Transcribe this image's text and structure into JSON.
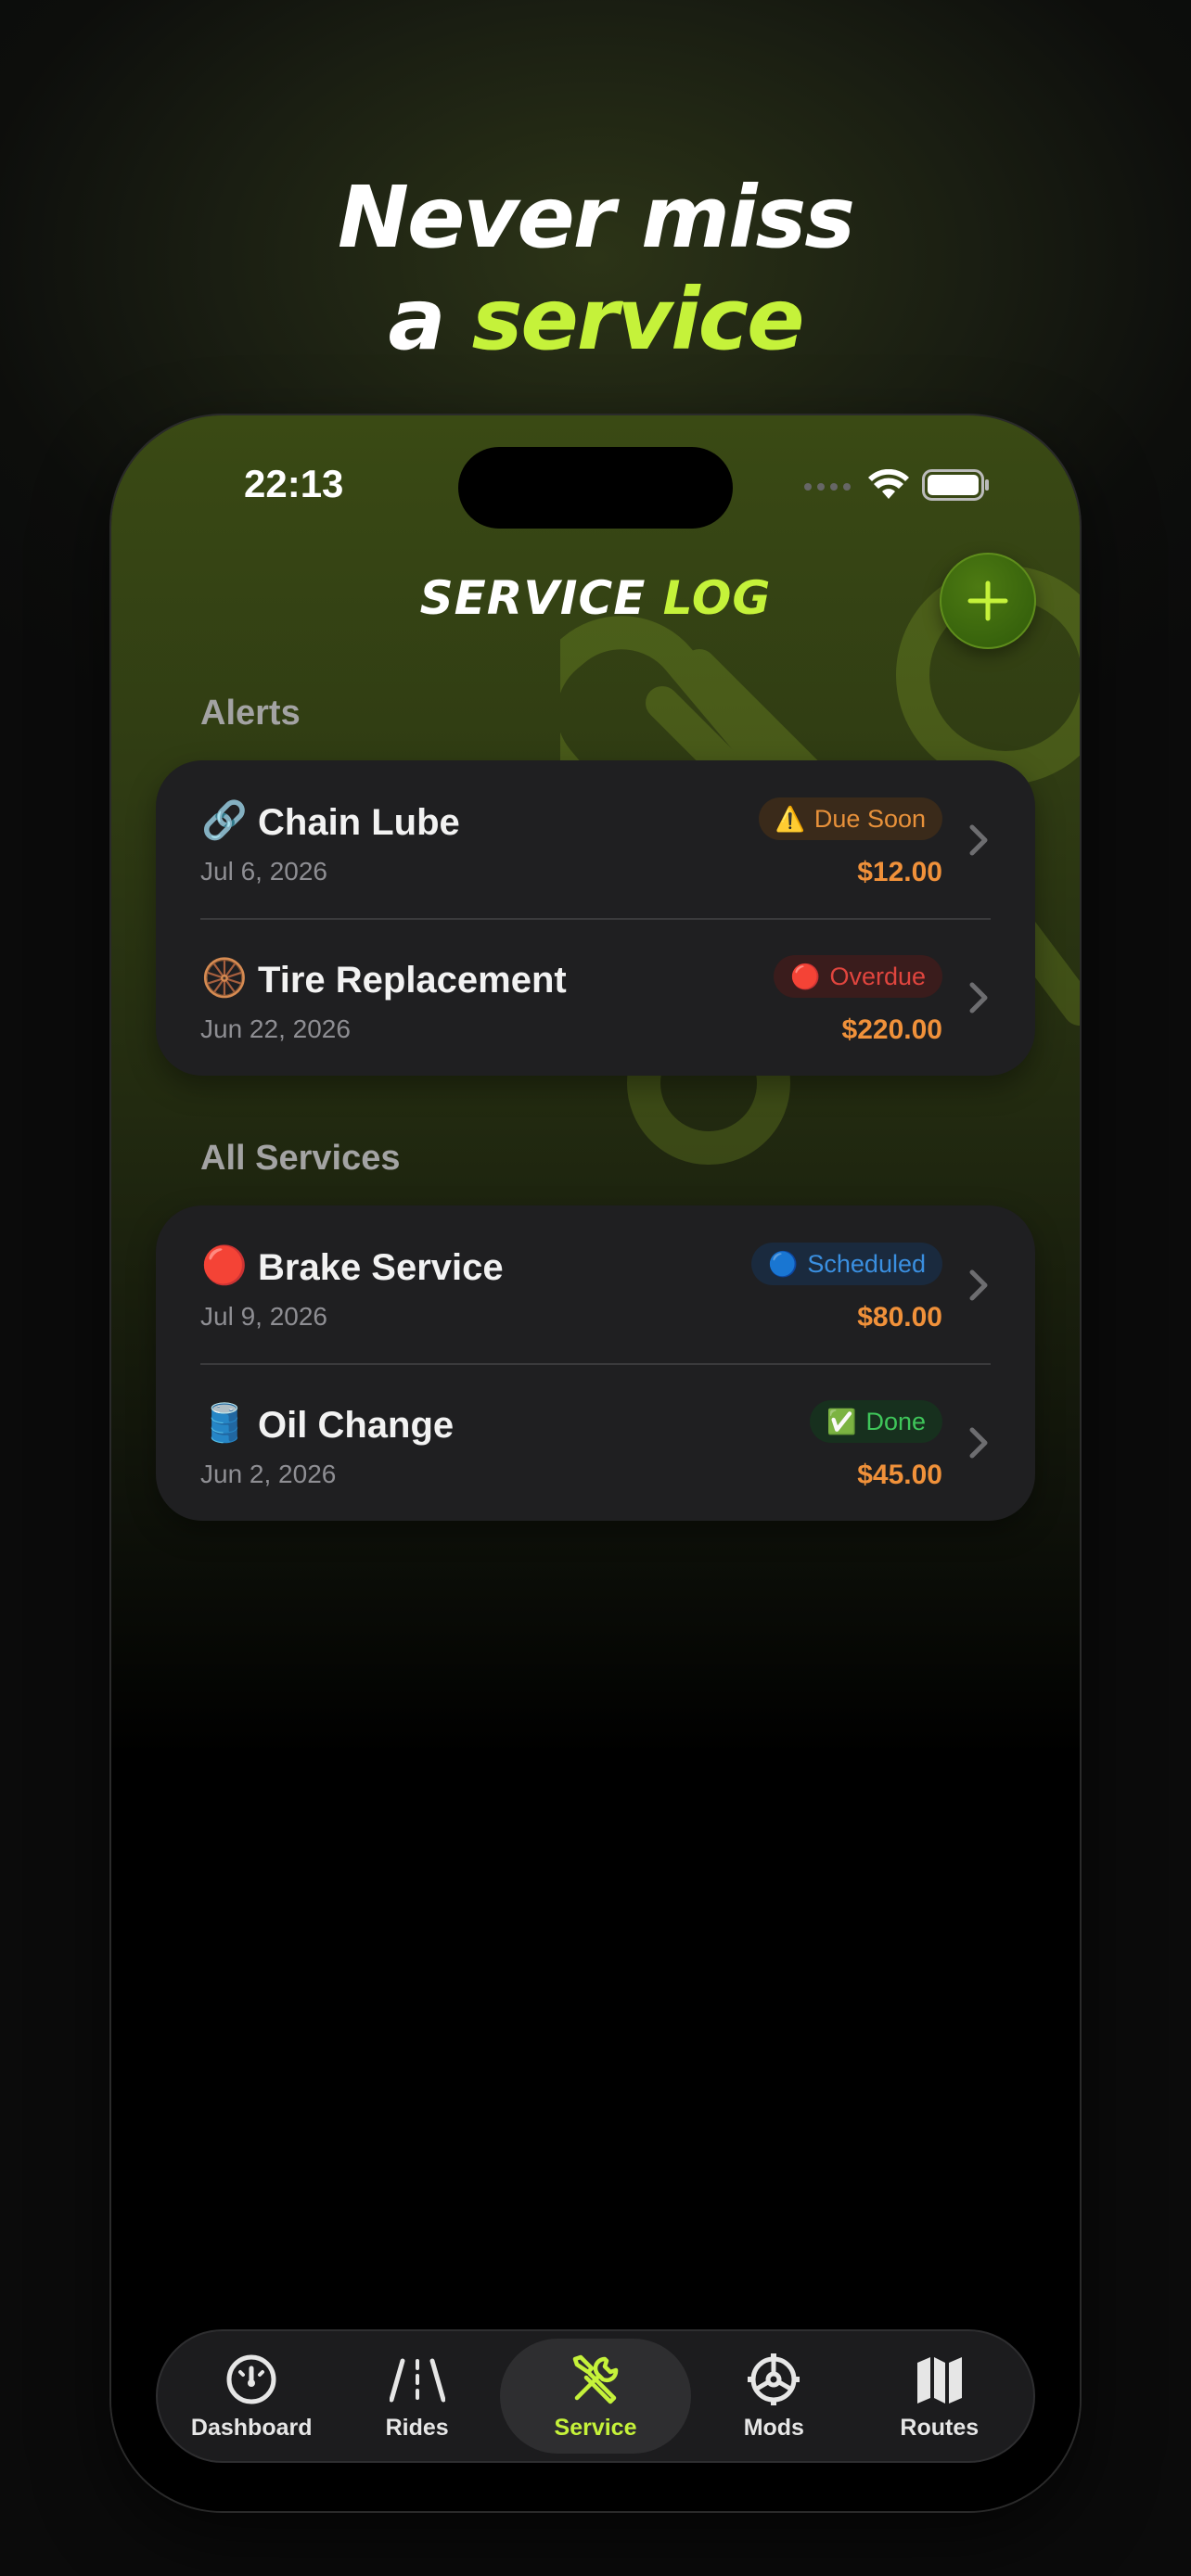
{
  "headline": {
    "line1": "Never miss",
    "line2_prefix": "a ",
    "line2_accent": "service"
  },
  "status_bar": {
    "time": "22:13"
  },
  "header": {
    "title_part1": "SERVICE ",
    "title_part2": "LOG",
    "add_icon": "plus-icon"
  },
  "alerts": {
    "label": "Alerts",
    "items": [
      {
        "emoji": "🔗",
        "name": "Chain Lube",
        "date": "Jul 6, 2026",
        "status_icon": "⚠️",
        "status": "Due Soon",
        "price": "$12.00"
      },
      {
        "emoji": "🛞",
        "name": "Tire Replacement",
        "date": "Jun 22, 2026",
        "status_icon": "🔴",
        "status": "Overdue",
        "price": "$220.00"
      }
    ]
  },
  "all_services": {
    "label": "All Services",
    "items": [
      {
        "emoji": "🔴",
        "name": "Brake Service",
        "date": "Jul 9, 2026",
        "status_icon": "🔵",
        "status": "Scheduled",
        "price": "$80.00"
      },
      {
        "emoji": "🛢️",
        "name": "Oil Change",
        "date": "Jun 2, 2026",
        "status_icon": "✅",
        "status": "Done",
        "price": "$45.00"
      }
    ]
  },
  "tabs": [
    {
      "label": "Dashboard",
      "icon": "gauge-icon"
    },
    {
      "label": "Rides",
      "icon": "road-icon"
    },
    {
      "label": "Service",
      "icon": "wrench-screwdriver-icon",
      "active": true
    },
    {
      "label": "Mods",
      "icon": "gear-icon"
    },
    {
      "label": "Routes",
      "icon": "map-icon"
    }
  ],
  "colors": {
    "accent": "#c5f23a",
    "price": "#f0913a",
    "due_soon": "#e8913a",
    "overdue": "#e0453e",
    "scheduled": "#3a8fe0",
    "done": "#3fc65a"
  }
}
